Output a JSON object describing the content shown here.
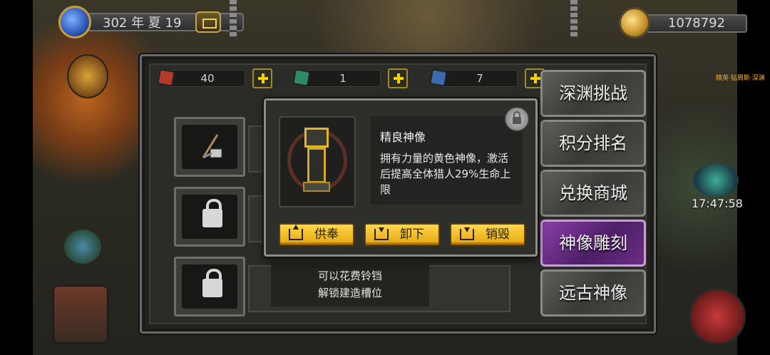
{
  "header": {
    "date": "302 年 夏 19",
    "gold": "1078792"
  },
  "resources": [
    {
      "id": "red-gem",
      "count": "40",
      "color": "#b33a2a"
    },
    {
      "id": "green-gem",
      "count": "1",
      "color": "#2f8a6a"
    },
    {
      "id": "blue-gem",
      "count": "7",
      "color": "#3b6bb0"
    }
  ],
  "side_tabs": [
    {
      "label": "深渊挑战",
      "active": false
    },
    {
      "label": "积分排名",
      "active": false
    },
    {
      "label": "兑换商城",
      "active": false
    },
    {
      "label": "神像雕刻",
      "active": true
    },
    {
      "label": "远古神像",
      "active": false
    }
  ],
  "unlock_hint": {
    "line1": "可以花费铃铛",
    "line2": "解锁建造槽位"
  },
  "popup": {
    "item_name": "精良神像",
    "item_desc": "拥有力量的黄色神像，激活后提高全体猎人29%生命上限",
    "buttons": {
      "offer": "供奉",
      "unequip": "卸下",
      "destroy": "销毁"
    }
  },
  "map": {
    "timer": "17:47:58",
    "label": "精英·钻屑斯·深渊"
  },
  "colors": {
    "accent_yellow": "#ffd74a",
    "active_tab": "#8a3fa8",
    "panel_bg": "#2b2b28"
  }
}
